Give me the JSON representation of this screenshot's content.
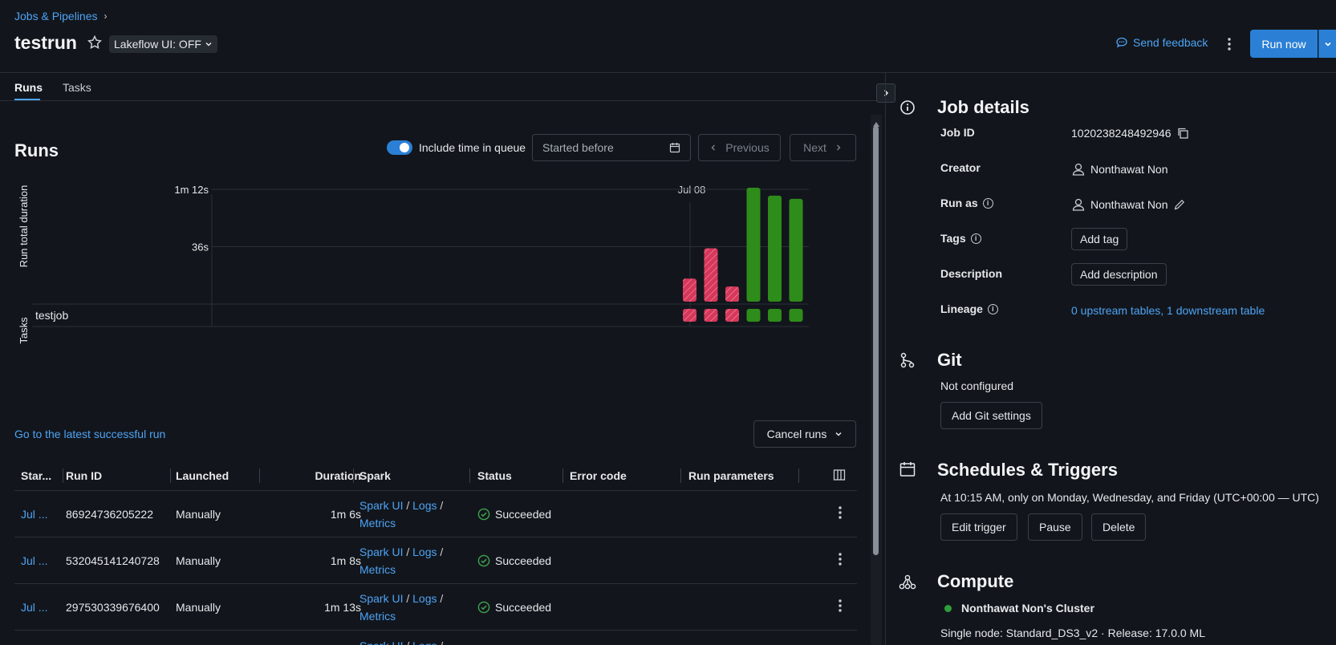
{
  "breadcrumb": {
    "parent": "Jobs & Pipelines",
    "sep": "›"
  },
  "header": {
    "title": "testrun",
    "lakeflow_toggle": "Lakeflow UI: OFF",
    "send_feedback": "Send feedback",
    "run_now": "Run now"
  },
  "tabs": [
    {
      "label": "Runs"
    },
    {
      "label": "Tasks"
    }
  ],
  "runs_section": {
    "heading": "Runs",
    "include_queue_label": "Include time in queue",
    "include_queue_on": true,
    "started_before_placeholder": "Started before",
    "previous_label": "Previous",
    "next_label": "Next",
    "latest_run_link": "Go to the latest successful run",
    "cancel_runs_label": "Cancel runs"
  },
  "chart_data": {
    "type": "bar",
    "date_label": "Jul 08",
    "ylabel": "Run total duration",
    "task_axis_label": "Tasks",
    "y_ticks": [
      "1m 12s",
      "36s"
    ],
    "y_tick_values": [
      72,
      36
    ],
    "ylim": [
      0,
      76
    ],
    "task_row_label": "testjob",
    "runs": [
      {
        "duration_s": 16,
        "status": "failed"
      },
      {
        "duration_s": 35,
        "status": "failed"
      },
      {
        "duration_s": 11,
        "status": "failed"
      },
      {
        "duration_s": 73,
        "status": "succeeded"
      },
      {
        "duration_s": 68,
        "status": "succeeded"
      },
      {
        "duration_s": 66,
        "status": "succeeded"
      }
    ],
    "colors": {
      "failed": "#d6375a",
      "succeeded": "#2e8c1a",
      "grid": "#2a2f36"
    }
  },
  "table": {
    "headers": [
      "Star...",
      "Run ID",
      "Launched",
      "Duration",
      "Spark",
      "Status",
      "Error code",
      "Run parameters"
    ],
    "rows": [
      {
        "start": "Jul ...",
        "run_id": "86924736205222",
        "launched": "Manually",
        "duration": "1m 6s",
        "status": "Succeeded"
      },
      {
        "start": "Jul ...",
        "run_id": "532045141240728",
        "launched": "Manually",
        "duration": "1m 8s",
        "status": "Succeeded"
      },
      {
        "start": "Jul ...",
        "run_id": "297530339676400",
        "launched": "Manually",
        "duration": "1m 13s",
        "status": "Succeeded"
      },
      {
        "start": "",
        "run_id": "",
        "launched": "",
        "duration": "",
        "status": ""
      }
    ],
    "spark": {
      "ui": "Spark UI",
      "slash": "/",
      "logs": "Logs",
      "metrics": "Metrics"
    }
  },
  "job_details": {
    "heading": "Job details",
    "job_id_label": "Job ID",
    "job_id": "1020238248492946",
    "creator_label": "Creator",
    "creator": "Nonthawat Non",
    "run_as_label": "Run as",
    "run_as": "Nonthawat Non",
    "tags_label": "Tags",
    "add_tag": "Add tag",
    "description_label": "Description",
    "add_description": "Add description",
    "lineage_label": "Lineage",
    "lineage_value": "0 upstream tables, 1 downstream table"
  },
  "git": {
    "heading": "Git",
    "status": "Not configured",
    "add_settings": "Add Git settings"
  },
  "schedules": {
    "heading": "Schedules & Triggers",
    "schedule_text": "At 10:15 AM, only on Monday, Wednesday, and Friday (UTC+00:00 — UTC)",
    "edit_trigger": "Edit trigger",
    "pause": "Pause",
    "delete": "Delete"
  },
  "compute": {
    "heading": "Compute",
    "cluster_name": "Nonthawat Non's Cluster",
    "cluster_desc": "Single node: Standard_DS3_v2 · Release: 17.0.0 ML",
    "status_color": "#2e9e3a"
  }
}
